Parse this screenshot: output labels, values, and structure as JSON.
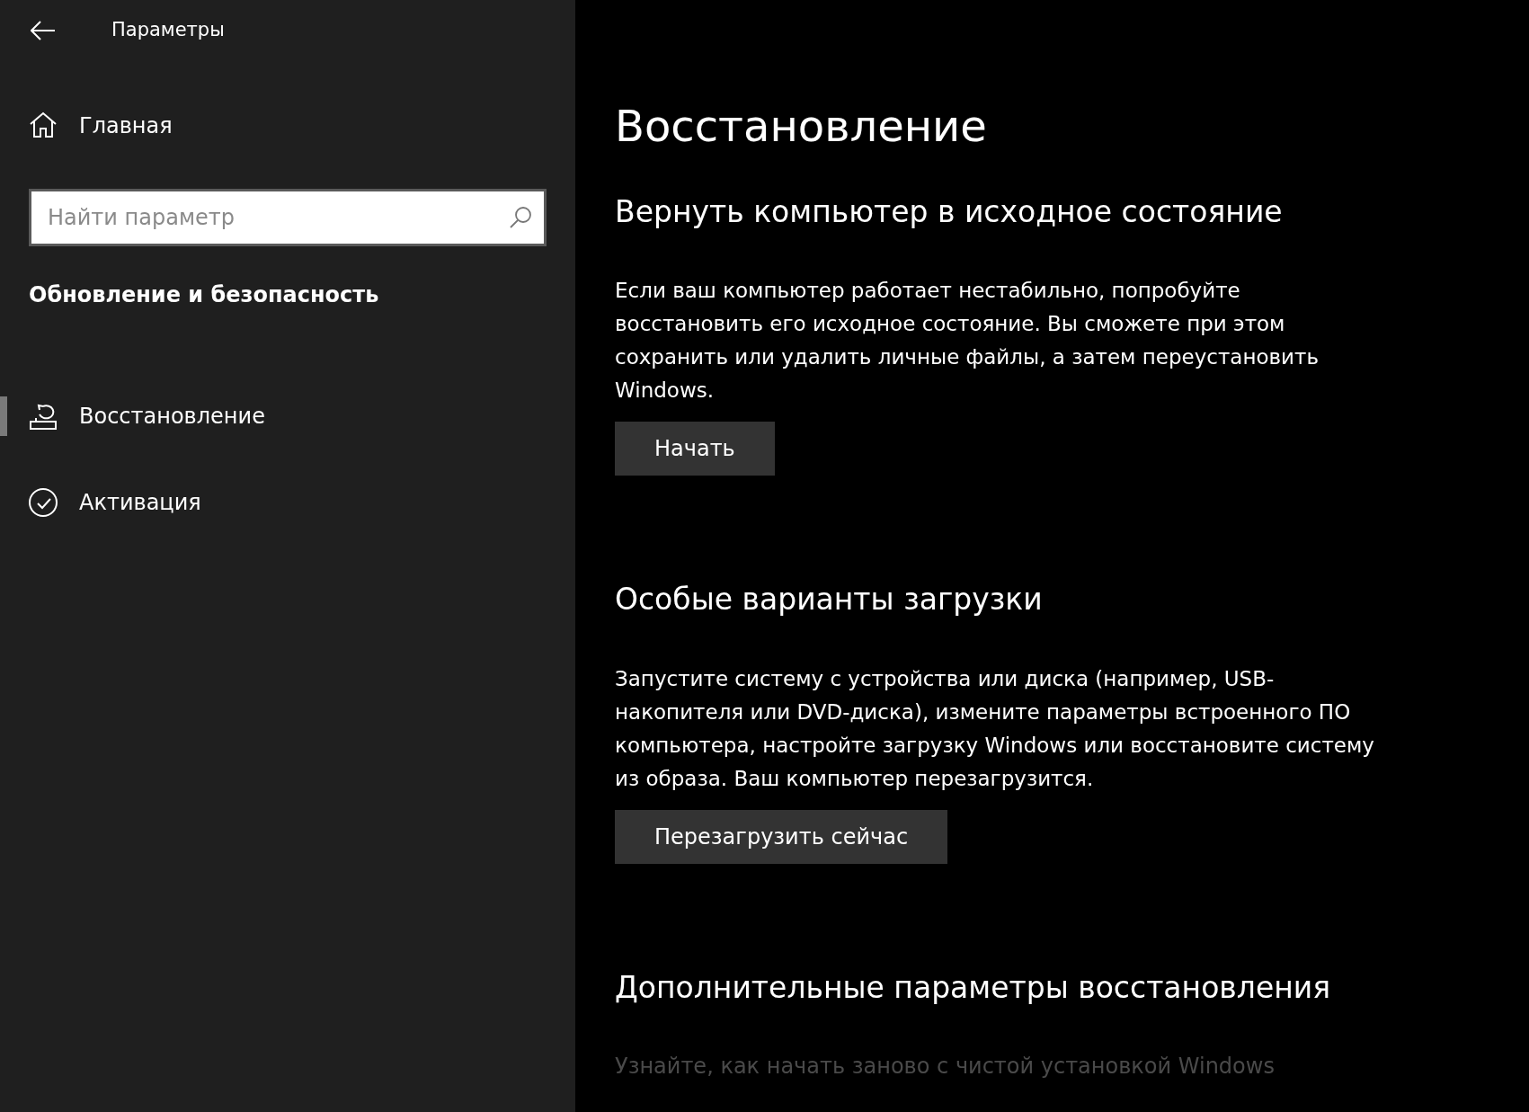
{
  "window": {
    "title": "Параметры"
  },
  "sidebar": {
    "home": "Главная",
    "search": {
      "placeholder": "Найти параметр"
    },
    "section": "Обновление и безопасность",
    "items": [
      {
        "label": "Восстановление",
        "kind": "recovery",
        "selected": true
      },
      {
        "label": "Активация",
        "kind": "activation",
        "selected": false
      }
    ]
  },
  "page": {
    "title": "Восстановление",
    "sections": [
      {
        "heading": "Вернуть компьютер в исходное состояние",
        "text": "Если ваш компьютер работает нестабильно, попробуйте восстановить его исходное состояние. Вы сможете при этом сохранить или удалить личные файлы, а затем переустановить Windows.",
        "button": "Начать"
      },
      {
        "heading": "Особые варианты загрузки",
        "text": "Запустите систему с устройства или диска (например, USB-накопителя или DVD-диска), измените параметры встроенного ПО компьютера, настройте загрузку Windows или восстановите систему из образа. Ваш компьютер перезагрузится.",
        "button": "Перезагрузить сейчас"
      },
      {
        "heading": "Дополнительные параметры восстановления",
        "link": {
          "text": "Узнайте, как начать заново с чистой установкой Windows",
          "disabled": true
        }
      }
    ]
  }
}
